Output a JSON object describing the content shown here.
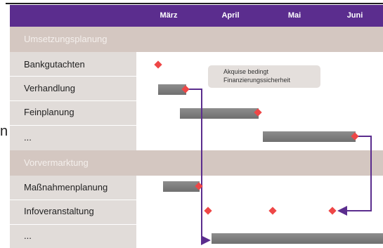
{
  "months": [
    "März",
    "April",
    "Mai",
    "Juni"
  ],
  "sections": [
    {
      "label": "Umsetzungsplanung"
    },
    {
      "label": "Vorvermarktung"
    }
  ],
  "rows": [
    {
      "label": "Bankgutachten"
    },
    {
      "label": "Verhandlung"
    },
    {
      "label": "Feinplanung"
    },
    {
      "label": "..."
    },
    {
      "label": "Maßnahmenplanung"
    },
    {
      "label": "Infoveranstaltung"
    },
    {
      "label": "..."
    }
  ],
  "note": {
    "line1": "Akquise bedingt",
    "line2": "Finanzierungssicherheit"
  },
  "edge_glyph": "n",
  "colors": {
    "header": "#5b2d8e",
    "label_column": "#e1dcd9",
    "section_band": "#d4c7c1",
    "bar": "#7d7d7d",
    "milestone": "#ee4747",
    "arrow": "#5b2d8e"
  }
}
